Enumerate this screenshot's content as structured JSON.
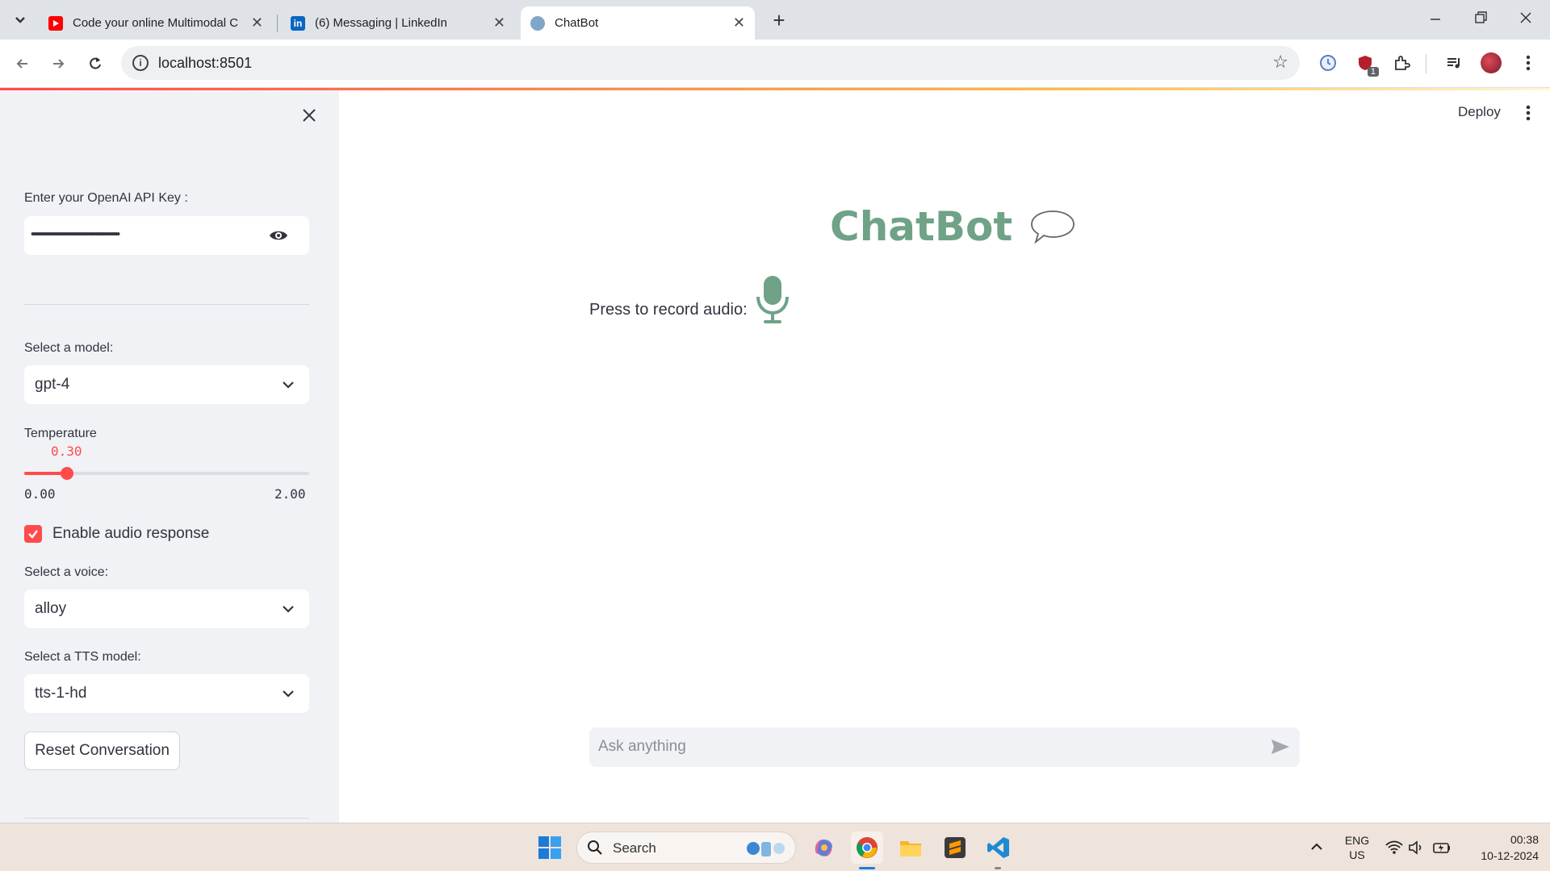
{
  "browser": {
    "tabs": [
      {
        "title": "Code your online Multimodal C",
        "icon": "youtube-icon"
      },
      {
        "title": "(6) Messaging | LinkedIn",
        "icon": "linkedin-icon"
      },
      {
        "title": "ChatBot",
        "icon": "chatbot-favicon-icon"
      }
    ],
    "url": "localhost:8501",
    "extension_badge": "1"
  },
  "app_header": {
    "deploy_label": "Deploy"
  },
  "sidebar": {
    "api_key_label": "Enter your OpenAI API Key :",
    "api_key_masked": "••••••••••••••••••••••••••••••••••••••••••••••••",
    "model_label": "Select a model:",
    "model_value": "gpt-4",
    "temperature_label": "Temperature",
    "temperature_value": "0.30",
    "temperature_min": "0.00",
    "temperature_max": "2.00",
    "temperature_fraction": 0.15,
    "audio_checkbox_label": "Enable audio response",
    "audio_checked": true,
    "voice_label": "Select a voice:",
    "voice_value": "alloy",
    "tts_label": "Select a TTS model:",
    "tts_value": "tts-1-hd",
    "reset_button": "Reset Conversation"
  },
  "main": {
    "title": "ChatBot",
    "record_label": "Press to record audio:",
    "chat_placeholder": "Ask anything"
  },
  "taskbar": {
    "search_label": "Search",
    "lang_top": "ENG",
    "lang_bottom": "US",
    "time": "00:38",
    "date": "10-12-2024"
  },
  "colors": {
    "accent": "#ff4b4b",
    "title_green": "#6fa287",
    "sidebar_bg": "#f0f2f6"
  }
}
